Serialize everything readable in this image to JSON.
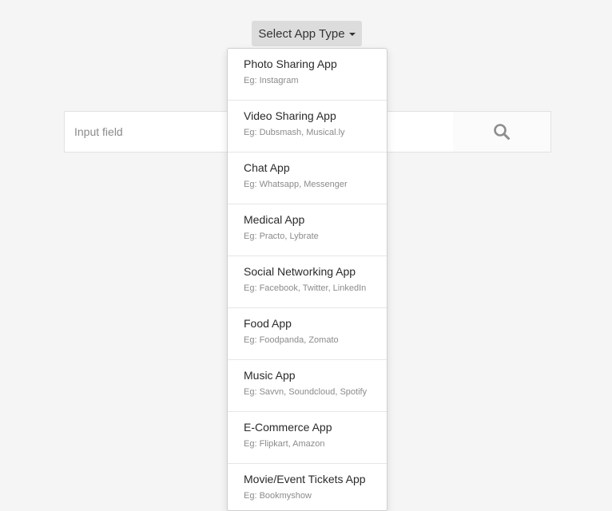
{
  "dropdown": {
    "toggle_label": "Select App Type",
    "items": [
      {
        "title": "Photo Sharing App",
        "example": "Eg: Instagram"
      },
      {
        "title": "Video Sharing App",
        "example": "Eg: Dubsmash, Musical.ly"
      },
      {
        "title": "Chat App",
        "example": "Eg: Whatsapp, Messenger"
      },
      {
        "title": "Medical App",
        "example": "Eg: Practo, Lybrate"
      },
      {
        "title": "Social Networking App",
        "example": "Eg: Facebook, Twitter, LinkedIn"
      },
      {
        "title": "Food App",
        "example": "Eg: Foodpanda, Zomato"
      },
      {
        "title": "Music App",
        "example": "Eg: Savvn, Soundcloud, Spotify"
      },
      {
        "title": "E-Commerce App",
        "example": "Eg: Flipkart, Amazon"
      },
      {
        "title": "Movie/Event Tickets App",
        "example": "Eg: Bookmyshow"
      }
    ]
  },
  "search": {
    "placeholder": "Input field",
    "icon": "search-icon"
  },
  "colors": {
    "background": "#f5f5f5",
    "toggle_bg": "#dcdcdc",
    "border": "#e2e2e2",
    "icon": "#8e8e8e"
  }
}
